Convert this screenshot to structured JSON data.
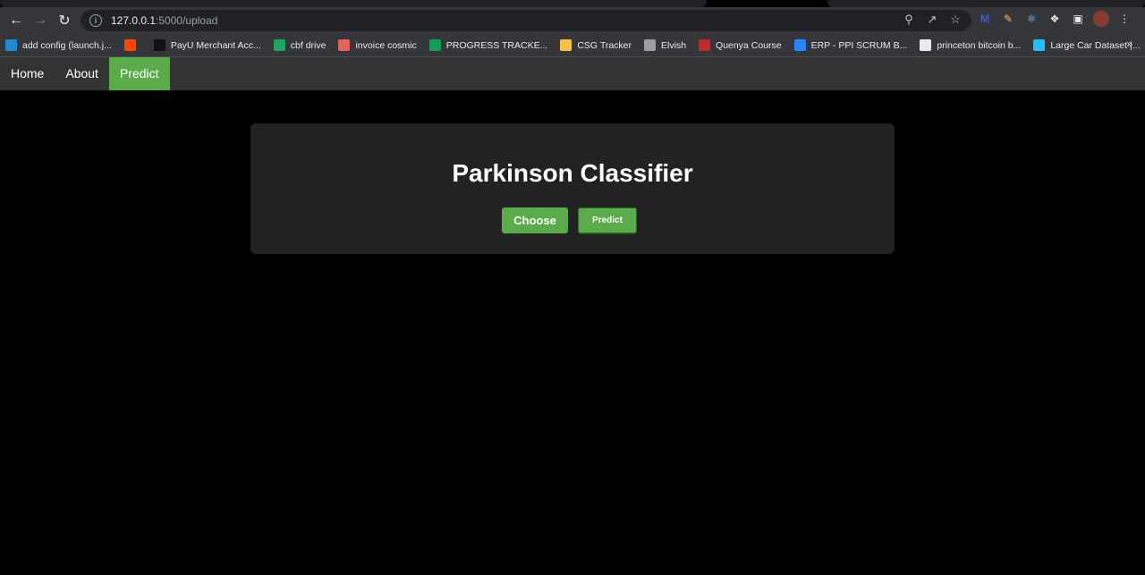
{
  "browser": {
    "url_host": "127.0.0.1",
    "url_path": ":5000/upload",
    "bookmarks": [
      {
        "label": "add config (launch.j...",
        "icon": "vscode-icon",
        "color": "#1f8ad2"
      },
      {
        "label": "",
        "icon": "reddit-icon",
        "color": "#ff4500"
      },
      {
        "label": "PayU Merchant Acc...",
        "icon": "payu-icon",
        "color": "#111111"
      },
      {
        "label": "cbf drive",
        "icon": "drive-icon",
        "color": "#1fa463"
      },
      {
        "label": "invoice cosmic",
        "icon": "cosmic-icon",
        "color": "#e0655a"
      },
      {
        "label": "PROGRESS TRACKE...",
        "icon": "sheets-icon",
        "color": "#0f9d58"
      },
      {
        "label": "CSG Tracker",
        "icon": "keep-icon",
        "color": "#f4c542"
      },
      {
        "label": "Elvish",
        "icon": "elvish-icon",
        "color": "#9e9e9e"
      },
      {
        "label": "Quenya Course",
        "icon": "quenya-icon",
        "color": "#c62828"
      },
      {
        "label": "ERP - PPI SCRUM B...",
        "icon": "jira-icon",
        "color": "#2684ff"
      },
      {
        "label": "princeton bitcoin b...",
        "icon": "globe-icon",
        "color": "#e8eaed"
      },
      {
        "label": "Large Car Dataset |...",
        "icon": "kaggle-icon",
        "color": "#20beff"
      }
    ],
    "more": "»"
  },
  "nav": {
    "home": "Home",
    "about": "About",
    "predict": "Predict"
  },
  "card": {
    "title": "Parkinson Classifier",
    "choose_label": "Choose",
    "predict_label": "Predict"
  },
  "colors": {
    "accent": "#5aac4b",
    "navbar": "#333333",
    "card": "#222222",
    "page": "#000000"
  }
}
